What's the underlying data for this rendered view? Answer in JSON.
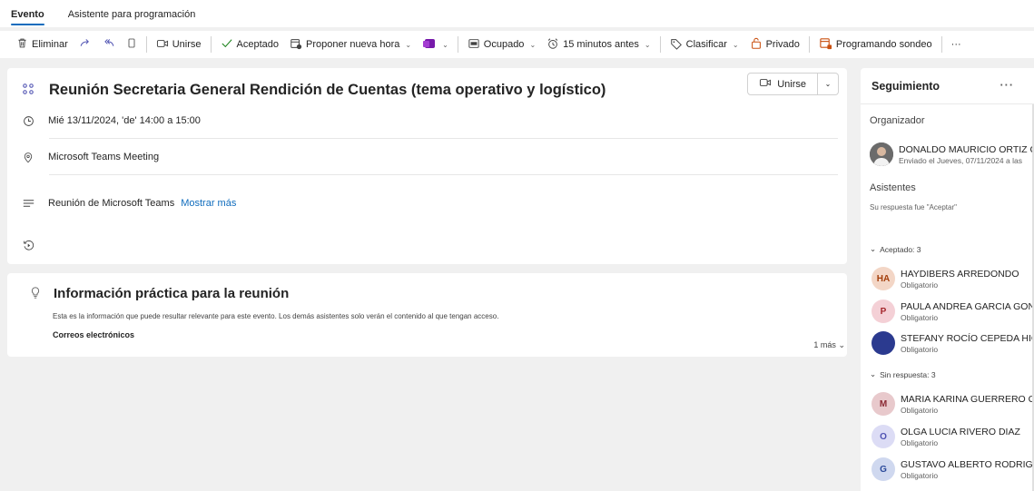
{
  "tabs": [
    {
      "label": "Evento",
      "active": true
    },
    {
      "label": "Asistente para programación",
      "active": false
    }
  ],
  "ribbon": {
    "delete": "Eliminar",
    "join": "Unirse",
    "accepted": "Aceptado",
    "propose": "Proponer nueva hora",
    "busy": "Ocupado",
    "reminder": "15 minutos antes",
    "categorize": "Clasificar",
    "private": "Privado",
    "poll": "Programando sondeo",
    "more": "···"
  },
  "event": {
    "title": "Reunión Secretaria General Rendición de Cuentas (tema operativo y logístico)",
    "join_label": "Unirse",
    "datetime": "Mié 13/11/2024, 'de' 14:00 a 15:00",
    "location": "Microsoft Teams Meeting",
    "body": "Reunión de Microsoft Teams",
    "show_more": "Mostrar más"
  },
  "practical": {
    "title": "Información práctica para la reunión",
    "description": "Esta es la información que puede resultar relevante para este evento. Los demás asistentes solo verán el contenido al que tengan acceso.",
    "emails_label": "Correos electrónicos",
    "more": "1 más"
  },
  "tracking": {
    "title": "Seguimiento",
    "more": "···",
    "organizer_label": "Organizador",
    "organizer_name": "DONALDO MAURICIO ORTIZ C",
    "organizer_sent": "Enviado el Jueves, 07/11/2024 a las",
    "attendees_label": "Asistentes",
    "response_text": "Su respuesta fue \"Aceptar\"",
    "accepted_group": "Aceptado: 3",
    "no_response_group": "Sin respuesta: 3",
    "accepted": [
      {
        "initials": "HA",
        "name": "HAYDIBERS ARREDONDO",
        "role": "Obligatorio",
        "bg": "#f3d6c6",
        "fg": "#a33e0b"
      },
      {
        "initials": "P",
        "name": "PAULA ANDREA GARCIA GON",
        "role": "Obligatorio",
        "bg": "#f4d0d6",
        "fg": "#a4262c"
      },
      {
        "initials": "",
        "name": "STEFANY ROCÍO CEPEDA HIG",
        "role": "Obligatorio",
        "bg": "#2b3a8f",
        "fg": "#ffffff"
      }
    ],
    "no_response": [
      {
        "initials": "M",
        "name": "MARIA KARINA GUERRERO C.",
        "role": "Obligatorio",
        "bg": "#e8c9cc",
        "fg": "#8a2a34"
      },
      {
        "initials": "O",
        "name": "OLGA LUCIA RIVERO DIAZ",
        "role": "Obligatorio",
        "bg": "#dcdcf5",
        "fg": "#4f52b2"
      },
      {
        "initials": "G",
        "name": "GUSTAVO ALBERTO RODRIGU",
        "role": "Obligatorio",
        "bg": "#cfd8ef",
        "fg": "#2b4a9a"
      }
    ]
  }
}
